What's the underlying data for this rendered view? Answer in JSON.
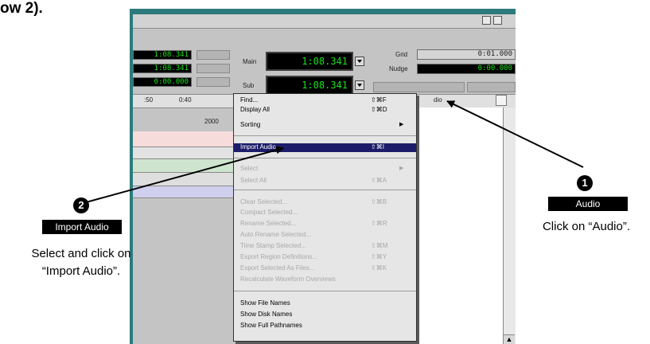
{
  "heading": "ow 2).",
  "counters": {
    "left": [
      "1:08.341",
      "1:08.341",
      "0:00.000"
    ],
    "main_label": "Main",
    "main_value": "1:08.341",
    "sub_label": "Sub",
    "sub_value": "1:08.341",
    "grid_label": "Grid",
    "grid_value": "0:01.000",
    "nudge_label": "Nudge",
    "nudge_value": "0:00.000"
  },
  "ruler": {
    "mark1": ":50",
    "mark2": "0:40",
    "value": "2000"
  },
  "menu": {
    "items": [
      {
        "label": "Find...",
        "shortcut": "⇧⌘F",
        "state": "enabled"
      },
      {
        "label": "Display All",
        "shortcut": "⇧⌘D",
        "state": "enabled"
      },
      {
        "label": "Sorting",
        "submenu": "▶",
        "state": "enabled"
      },
      {
        "label": "Import Audio...",
        "shortcut": "⇧⌘I",
        "state": "highlighted"
      },
      {
        "label": "Select",
        "submenu": "▶",
        "state": "disabled"
      },
      {
        "label": "Select All",
        "shortcut": "⇧⌘A",
        "state": "disabled"
      },
      {
        "label": "Clear Selected...",
        "shortcut": "⇧⌘B",
        "state": "disabled"
      },
      {
        "label": "Compact Selected...",
        "state": "disabled"
      },
      {
        "label": "Rename Selected...",
        "shortcut": "⇧⌘R",
        "state": "disabled"
      },
      {
        "label": "Auto Rename Selected...",
        "state": "disabled"
      },
      {
        "label": "Time Stamp Selected...",
        "shortcut": "⇧⌘M",
        "state": "disabled"
      },
      {
        "label": "Export Region Definitions...",
        "shortcut": "⇧⌘Y",
        "state": "disabled"
      },
      {
        "label": "Export Selected As Files...",
        "shortcut": "⇧⌘K",
        "state": "disabled"
      },
      {
        "label": "Recalculate Waveform Overviews",
        "state": "disabled"
      },
      {
        "label": "Show File Names",
        "state": "enabled"
      },
      {
        "label": "Show Disk Names",
        "state": "enabled"
      },
      {
        "label": "Show Full Pathnames",
        "state": "enabled"
      }
    ]
  },
  "audio_tab_label": "dio",
  "callout1": {
    "number": "1",
    "tag": "Audio",
    "caption": "Click on “Audio”."
  },
  "callout2": {
    "number": "2",
    "tag": "Import Audio",
    "caption_line1": "Select and click on",
    "caption_line2": "“Import Audio”."
  },
  "colors": {
    "window_frame": "#2c7a7c",
    "menu_highlight": "#1c1c6a",
    "counter_green": "#17e317"
  }
}
